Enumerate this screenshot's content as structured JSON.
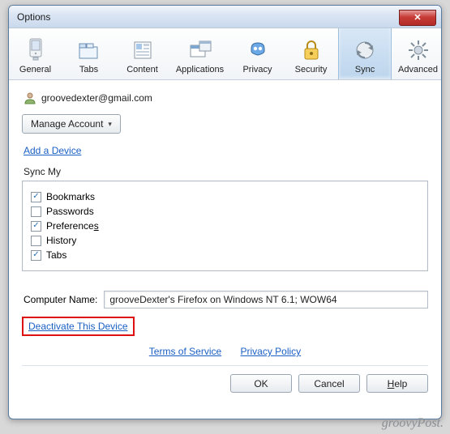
{
  "window": {
    "title": "Options",
    "close_glyph": "✕"
  },
  "tabs": [
    {
      "id": "general",
      "label": "General"
    },
    {
      "id": "tabs",
      "label": "Tabs"
    },
    {
      "id": "content",
      "label": "Content"
    },
    {
      "id": "applications",
      "label": "Applications"
    },
    {
      "id": "privacy",
      "label": "Privacy"
    },
    {
      "id": "security",
      "label": "Security"
    },
    {
      "id": "sync",
      "label": "Sync",
      "selected": true
    },
    {
      "id": "advanced",
      "label": "Advanced"
    }
  ],
  "sync": {
    "account_email": "groovedexter@gmail.com",
    "manage_account_label": "Manage Account",
    "add_device_label": "Add a Device",
    "section_label": "Sync My",
    "items": [
      {
        "label": "Bookmarks",
        "checked": true
      },
      {
        "label": "Passwords",
        "checked": false
      },
      {
        "label": "Preferences",
        "checked": true,
        "access": "s"
      },
      {
        "label": "History",
        "checked": false
      },
      {
        "label": "Tabs",
        "checked": true
      }
    ],
    "computer_name_label": "Computer Name:",
    "computer_name_value": "grooveDexter's Firefox on Windows NT 6.1; WOW64",
    "deactivate_label": "Deactivate This Device",
    "tos_label": "Terms of Service",
    "privacy_label": "Privacy Policy"
  },
  "buttons": {
    "ok": "OK",
    "cancel": "Cancel",
    "help": "Help"
  },
  "watermark": "groovyPost."
}
